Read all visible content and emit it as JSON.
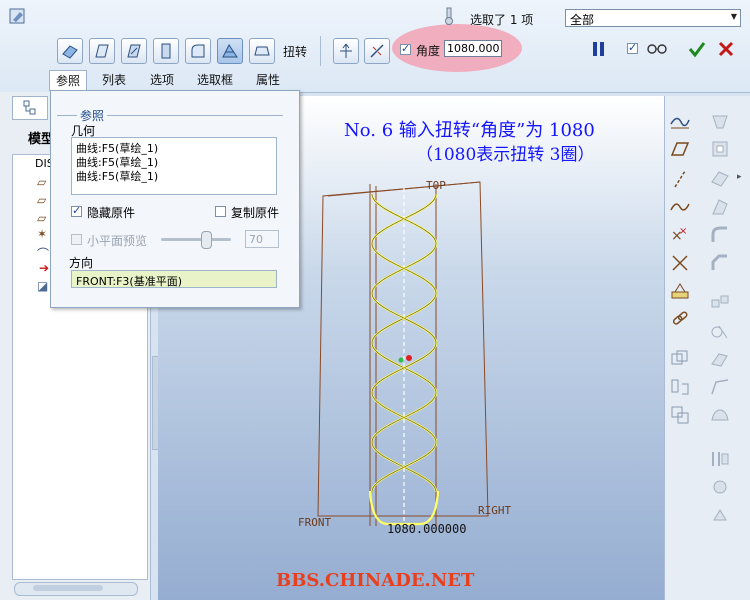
{
  "dashboard": {
    "twist_label": "扭转",
    "angle_label": "角度",
    "angle_value": "1080.0000",
    "selection_text": "选取了 1 项",
    "filter_value": "全部"
  },
  "tabs": [
    {
      "label": "参照"
    },
    {
      "label": "列表"
    },
    {
      "label": "选项"
    },
    {
      "label": "选取框"
    },
    {
      "label": "属性"
    }
  ],
  "refs_panel": {
    "group_title": "参照",
    "geometry_label": "几何",
    "geometry_items": [
      "曲线:F5(草绘_1)",
      "曲线:F5(草绘_1)",
      "曲线:F5(草绘_1)"
    ],
    "hide_original_label": "隐藏原件",
    "copy_original_label": "复制原件",
    "preview_label": "小平面预览",
    "preview_value": "70",
    "direction_label": "方向",
    "direction_value": "FRONT:F3(基准平面)"
  },
  "left_panel": {
    "model_tab_label": "模型",
    "tree_root": "DIS"
  },
  "viewport": {
    "annotation_line1": "No. 6 输入扭转“角度”为 1080",
    "annotation_line2": "（1080表示扭转 3圈）",
    "top_label": "TOP",
    "front_label": "FRONT",
    "right_label": "RIGHT",
    "dimension_label": "1080.000000",
    "watermark": "BBS.CHINADE.NET"
  },
  "colors": {
    "annotation": "#1515ff",
    "watermark": "#e8401e",
    "helix": "#ffff66",
    "frame": "#8a4a26",
    "highlight": "#f2a6b8"
  }
}
